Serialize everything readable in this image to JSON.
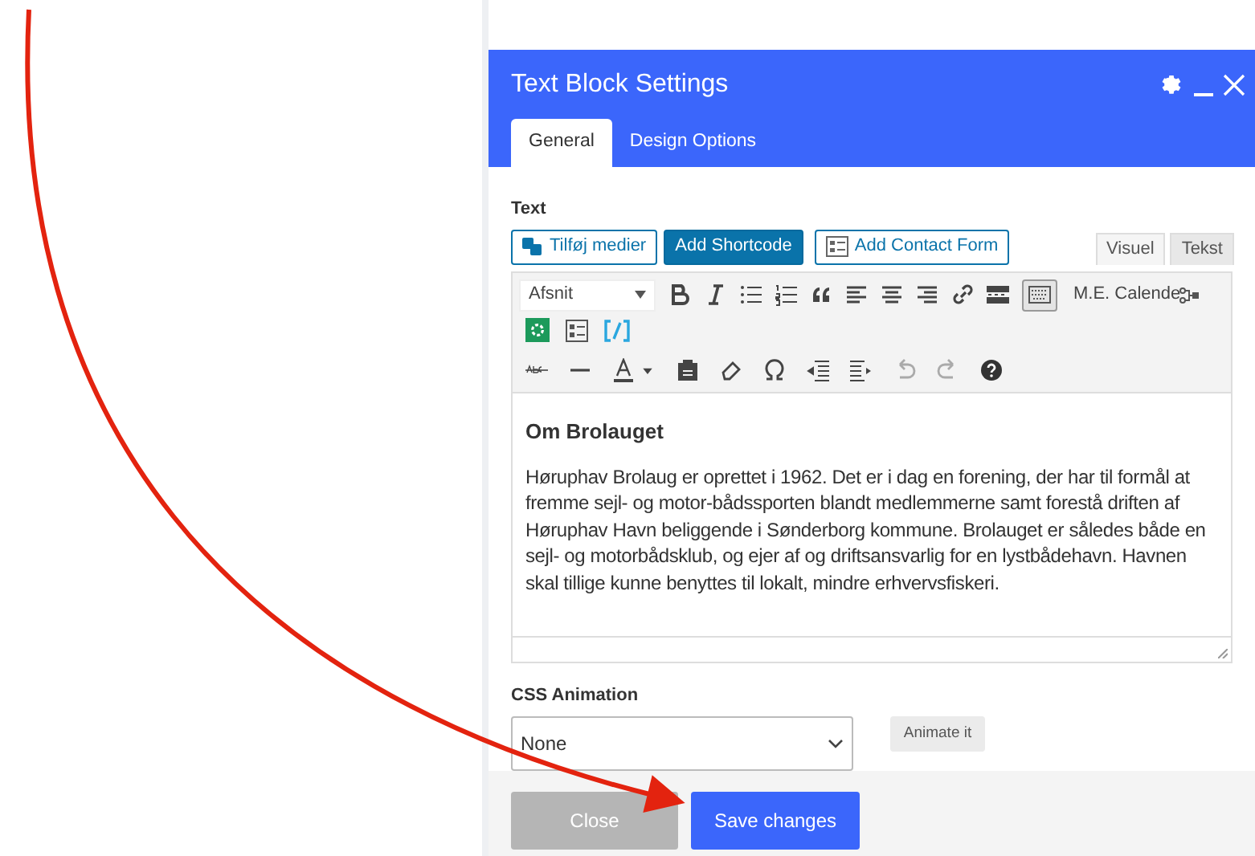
{
  "window": {
    "title": "Text Block Settings"
  },
  "tabs": [
    {
      "label": "General",
      "selected": true
    },
    {
      "label": "Design Options",
      "selected": false
    }
  ],
  "text_field": {
    "label": "Text",
    "media_buttons": [
      {
        "label": "Tilføj medier",
        "kind": "media"
      },
      {
        "label": "Add Shortcode",
        "kind": "primary"
      },
      {
        "label": "Add Contact Form",
        "kind": "form"
      }
    ],
    "editor_tabs": [
      {
        "label": "Visuel",
        "selected": true
      },
      {
        "label": "Tekst",
        "selected": false
      }
    ],
    "format_select": "Afsnit",
    "toolbar_toggle_pressed": true,
    "plugin_label": "M.E. Calende",
    "heading": "Om Brolauget",
    "paragraph": "Høruphav Brolaug er oprettet i 1962. Det er i dag en forening, der har til formål at fremme sejl- og motor-bådssporten blandt medlemmerne samt forestå driften af Høruphav Havn beliggende i Sønderborg kommune. Brolauget er således både en sejl- og motorbådsklub, og ejer af og driftsansvarlig for en lystbådehavn. Havnen skal tillige kunne benyttes til lokalt, mindre erhvervsfiskeri."
  },
  "css_animation": {
    "label": "CSS Animation",
    "value": "None",
    "button": "Animate it"
  },
  "footer": {
    "buttons": [
      {
        "label": "Close",
        "kind": "secondary"
      },
      {
        "label": "Save changes",
        "kind": "primary"
      }
    ]
  }
}
